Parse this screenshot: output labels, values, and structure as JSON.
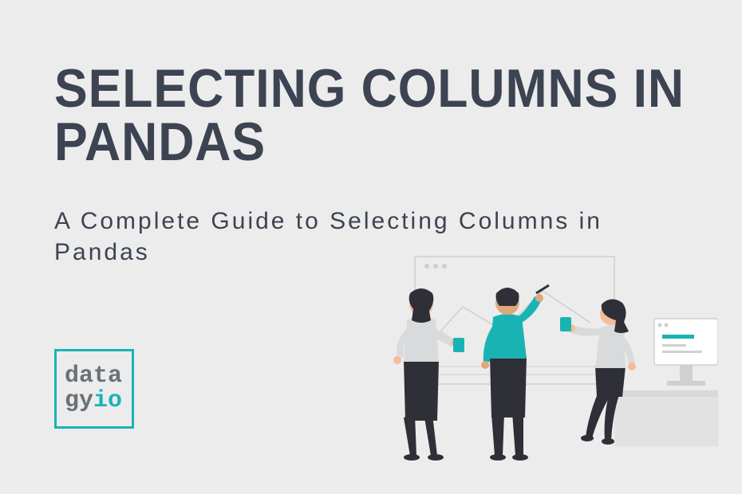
{
  "title": "SELECTING COLUMNS IN PANDAS",
  "subtitle": "A Complete Guide to Selecting Columns in Pandas",
  "logo": {
    "line1": "data",
    "line2_a": "gy",
    "line2_b": "io"
  },
  "colors": {
    "background": "#ececec",
    "text": "#3c4351",
    "accent": "#1ab3b3",
    "muted": "#6b7178"
  }
}
